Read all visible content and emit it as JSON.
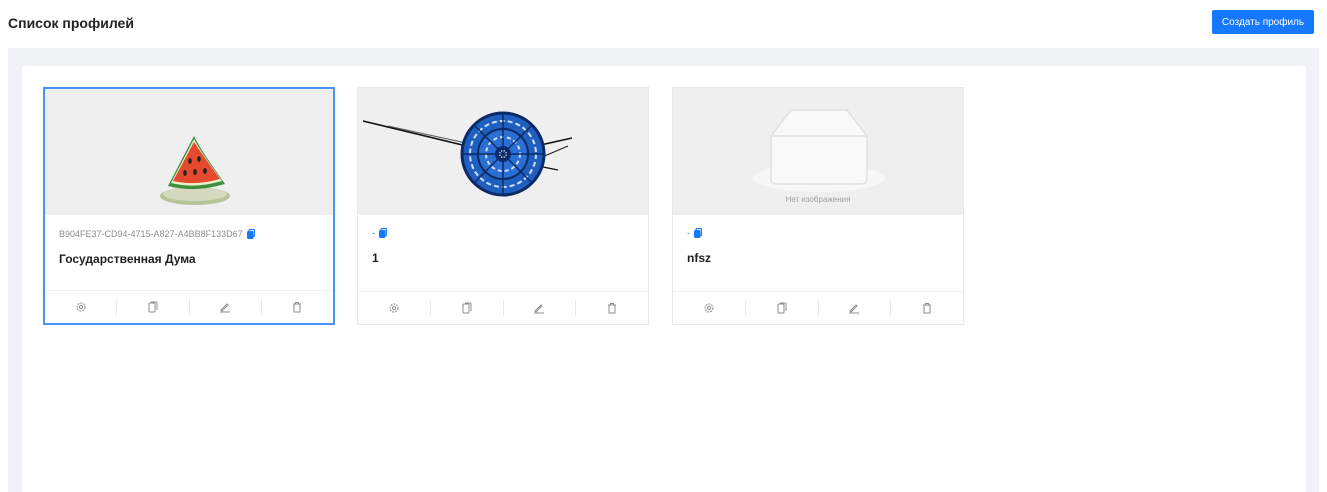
{
  "header": {
    "title": "Список профилей",
    "create_button": "Создать профиль"
  },
  "colors": {
    "primary": "#1677ff",
    "selected_border": "#4b93f0",
    "content_background": "#f0f2f5"
  },
  "profiles": [
    {
      "id": "B904FE37-CD94-4715-A827-A4BB8F133D67",
      "name": "Государственная Дума",
      "image": "watermelon-emblem",
      "selected": true
    },
    {
      "id": "-",
      "name": "1",
      "image": "blue-ornament-emblem",
      "selected": false
    },
    {
      "id": "-",
      "name": "nfsz",
      "image": "no-image-placeholder",
      "no_image_text": "Нет изображения",
      "selected": false
    }
  ],
  "card_action_icons": [
    "settings-icon",
    "copy-icon",
    "edit-icon",
    "delete-icon"
  ]
}
